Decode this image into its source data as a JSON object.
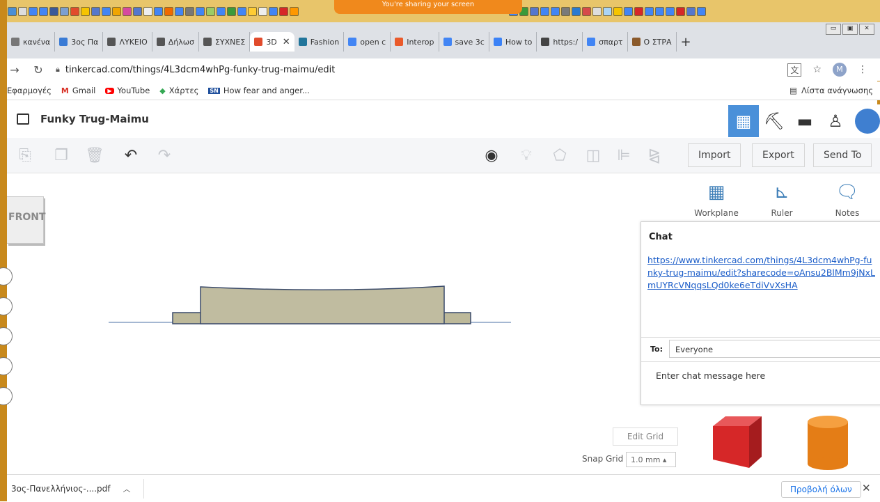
{
  "sharing_banner": "You're sharing your screen",
  "browser": {
    "tabs": [
      {
        "label": "κανένα",
        "color": "#777"
      },
      {
        "label": "3ος Πα",
        "color": "#3a7bd5"
      },
      {
        "label": "ΛΥΚΕΙΟ",
        "color": "#555"
      },
      {
        "label": "Δήλωσ",
        "color": "#555"
      },
      {
        "label": "ΣΥΧΝΕΣ",
        "color": "#555"
      },
      {
        "label": "3D",
        "color": "#e14b2c",
        "active": true
      },
      {
        "label": "Fashion",
        "color": "#21759b"
      },
      {
        "label": "open c",
        "color": "#4285f4"
      },
      {
        "label": "Interop",
        "color": "#ea5a2a"
      },
      {
        "label": "save 3c",
        "color": "#4285f4"
      },
      {
        "label": "How to",
        "color": "#3b82f6"
      },
      {
        "label": "https:/",
        "color": "#444"
      },
      {
        "label": "σπαρτ",
        "color": "#4285f4"
      },
      {
        "label": "Ο ΣΤΡΑ",
        "color": "#8b5a2b"
      }
    ],
    "new_tab": "+",
    "url": "tinkercad.com/things/4L3dcm4whPg-funky-trug-maimu/edit",
    "profile_initial": "M",
    "bookmarks": [
      {
        "label": "Εφαρμογές",
        "icon": "apps-icon"
      },
      {
        "label": "Gmail",
        "icon": "M"
      },
      {
        "label": "YouTube",
        "icon": "▶"
      },
      {
        "label": "Χάρτες",
        "icon": "◆"
      },
      {
        "label": "How fear and anger...",
        "icon": "SN"
      }
    ],
    "reading_list": "Λίστα ανάγνωσης"
  },
  "tinkercad": {
    "title": "Funky Trug-Maimu",
    "toolbar": {
      "import": "Import",
      "export": "Export",
      "send_to": "Send To"
    },
    "view_cube": "FRONT",
    "right_tools": [
      {
        "label": "Workplane",
        "icon": "workplane-icon"
      },
      {
        "label": "Ruler",
        "icon": "ruler-icon"
      },
      {
        "label": "Notes",
        "icon": "notes-icon"
      }
    ],
    "chat": {
      "title": "Chat",
      "link": "https://www.tinkercad.com/things/4L3dcm4whPg-funky-trug-maimu/edit?sharecode=oAnsu2BlMm9jNxLmUYRcVNqqsLQd0ke6eTdiVvXsHA",
      "to_label": "To:",
      "to_value": "Everyone",
      "input_placeholder": "Enter chat message here"
    },
    "edit_grid": "Edit Grid",
    "snap_grid_label": "Snap Grid",
    "snap_grid_value": "1.0 mm ▴",
    "shapes": [
      {
        "name": "Box",
        "color": "#d62728"
      },
      {
        "name": "Cylinder",
        "color": "#f0861a"
      }
    ]
  },
  "downloads": {
    "file": "3ος-Πανελλήνιος-....pdf",
    "show_all": "Προβολή όλων",
    "close": "✕"
  }
}
